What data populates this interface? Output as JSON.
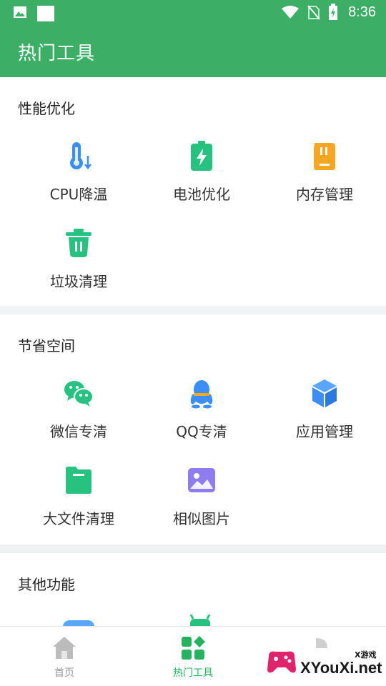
{
  "status_bar": {
    "time": "8:36"
  },
  "app_bar": {
    "title": "热门工具"
  },
  "sections": [
    {
      "title": "性能优化",
      "items": [
        {
          "label": "CPU降温",
          "icon": "thermometer-icon",
          "color": "#3a8ef6"
        },
        {
          "label": "电池优化",
          "icon": "battery-charging-icon",
          "color": "#27c27f"
        },
        {
          "label": "内存管理",
          "icon": "memory-card-icon",
          "color": "#f5a623"
        },
        {
          "label": "垃圾清理",
          "icon": "trash-icon",
          "color": "#27c27f"
        }
      ]
    },
    {
      "title": "节省空间",
      "items": [
        {
          "label": "微信专清",
          "icon": "wechat-icon",
          "color": "#27c27f"
        },
        {
          "label": "QQ专清",
          "icon": "qq-icon",
          "color": "#3a8ef6"
        },
        {
          "label": "应用管理",
          "icon": "cube-icon",
          "color": "#3a8ef6"
        },
        {
          "label": "大文件清理",
          "icon": "folder-icon",
          "color": "#27c27f"
        },
        {
          "label": "相似图片",
          "icon": "image-icon",
          "color": "#8e7cf0"
        }
      ]
    },
    {
      "title": "其他功能",
      "items": []
    }
  ],
  "bottom_nav": {
    "items": [
      {
        "label": "首页",
        "icon": "home-icon",
        "active": false
      },
      {
        "label": "热门工具",
        "icon": "apps-icon",
        "active": true
      }
    ],
    "active_color": "#27b25f",
    "inactive_color": "#9a9a9a"
  },
  "watermark": {
    "text": "XYouXi.net",
    "small": "X游戏"
  },
  "colors": {
    "primary": "#3dae66"
  }
}
